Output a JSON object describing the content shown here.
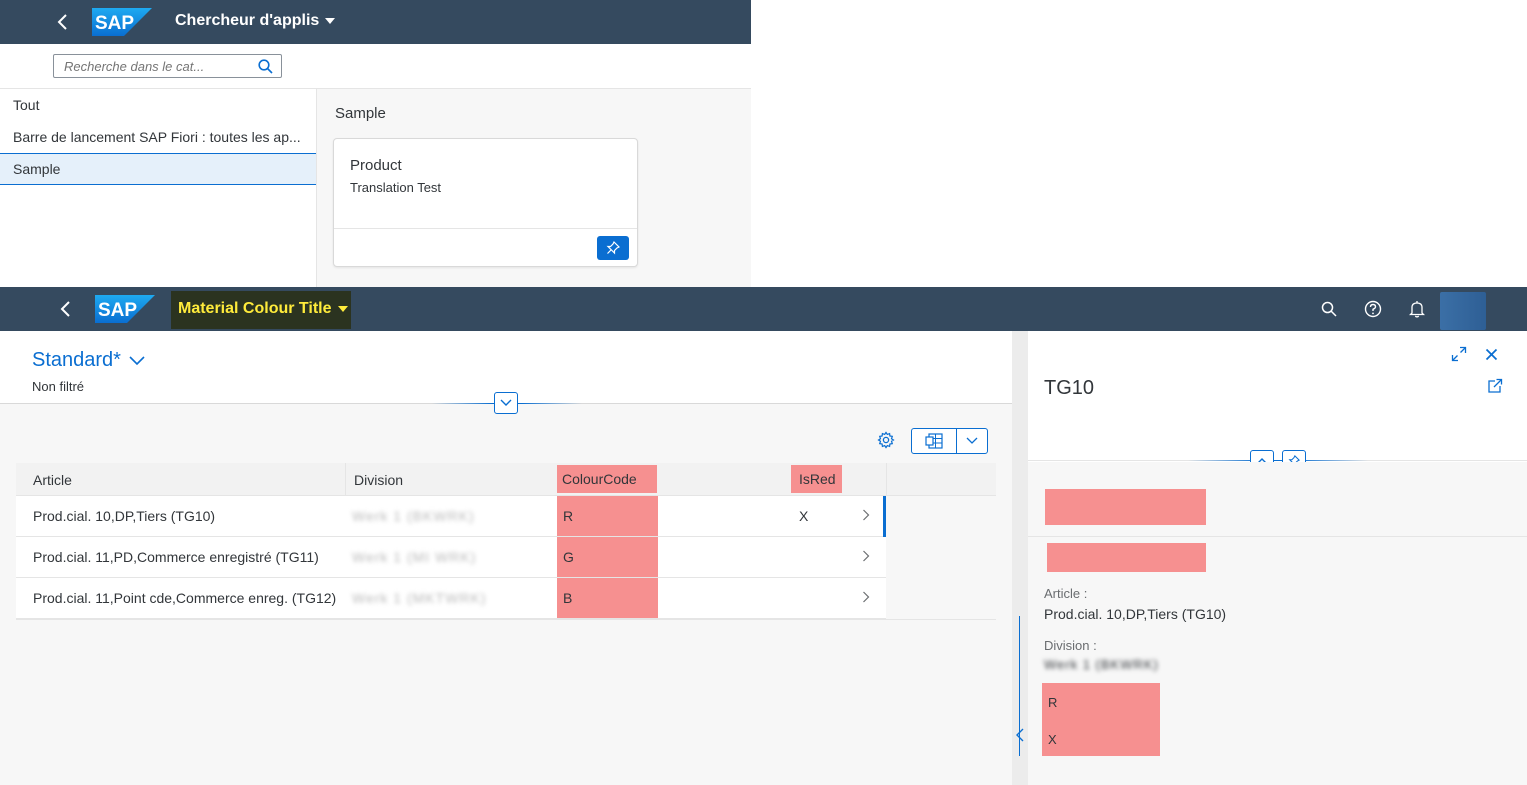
{
  "finder": {
    "shell_title": "Chercheur d'applis",
    "search_placeholder": "Recherche dans le cat...",
    "nav": [
      {
        "label": "Tout"
      },
      {
        "label": "Barre de lancement SAP Fiori : toutes les ap..."
      },
      {
        "label": "Sample"
      }
    ],
    "group_title": "Sample",
    "tile": {
      "title": "Product",
      "subtitle": "Translation Test"
    }
  },
  "app": {
    "shell_title": "Material Colour Title",
    "variant": "Standard*",
    "filter_status": "Non filtré",
    "table": {
      "columns": [
        "Article",
        "Division",
        "ColourCode",
        "IsRed"
      ],
      "rows": [
        {
          "article": "Prod.cial. 10,DP,Tiers (TG10)",
          "division": "Werk 1 (BKWRK)",
          "colour": "R",
          "isred": "X"
        },
        {
          "article": "Prod.cial. 11,PD,Commerce enregistré (TG11)",
          "division": "Werk 1 (MI WRK)",
          "colour": "G",
          "isred": ""
        },
        {
          "article": "Prod.cial. 11,Point cde,Commerce enreg. (TG12)",
          "division": "Werk 1 (MKTWRK)",
          "colour": "B",
          "isred": ""
        }
      ]
    },
    "detail": {
      "title": "TG10",
      "article_label": "Article :",
      "article_value": "Prod.cial. 10,DP,Tiers (TG10)",
      "division_label": "Division :",
      "division_value": "Werk 1 (BKWRK)",
      "colour_value": "R",
      "isred_value": "X"
    }
  },
  "colors": {
    "shell": "#354a5f",
    "accent": "#0a6ed1",
    "highlight_red": "#f69090",
    "title_yellow": "#ffeb3b"
  }
}
